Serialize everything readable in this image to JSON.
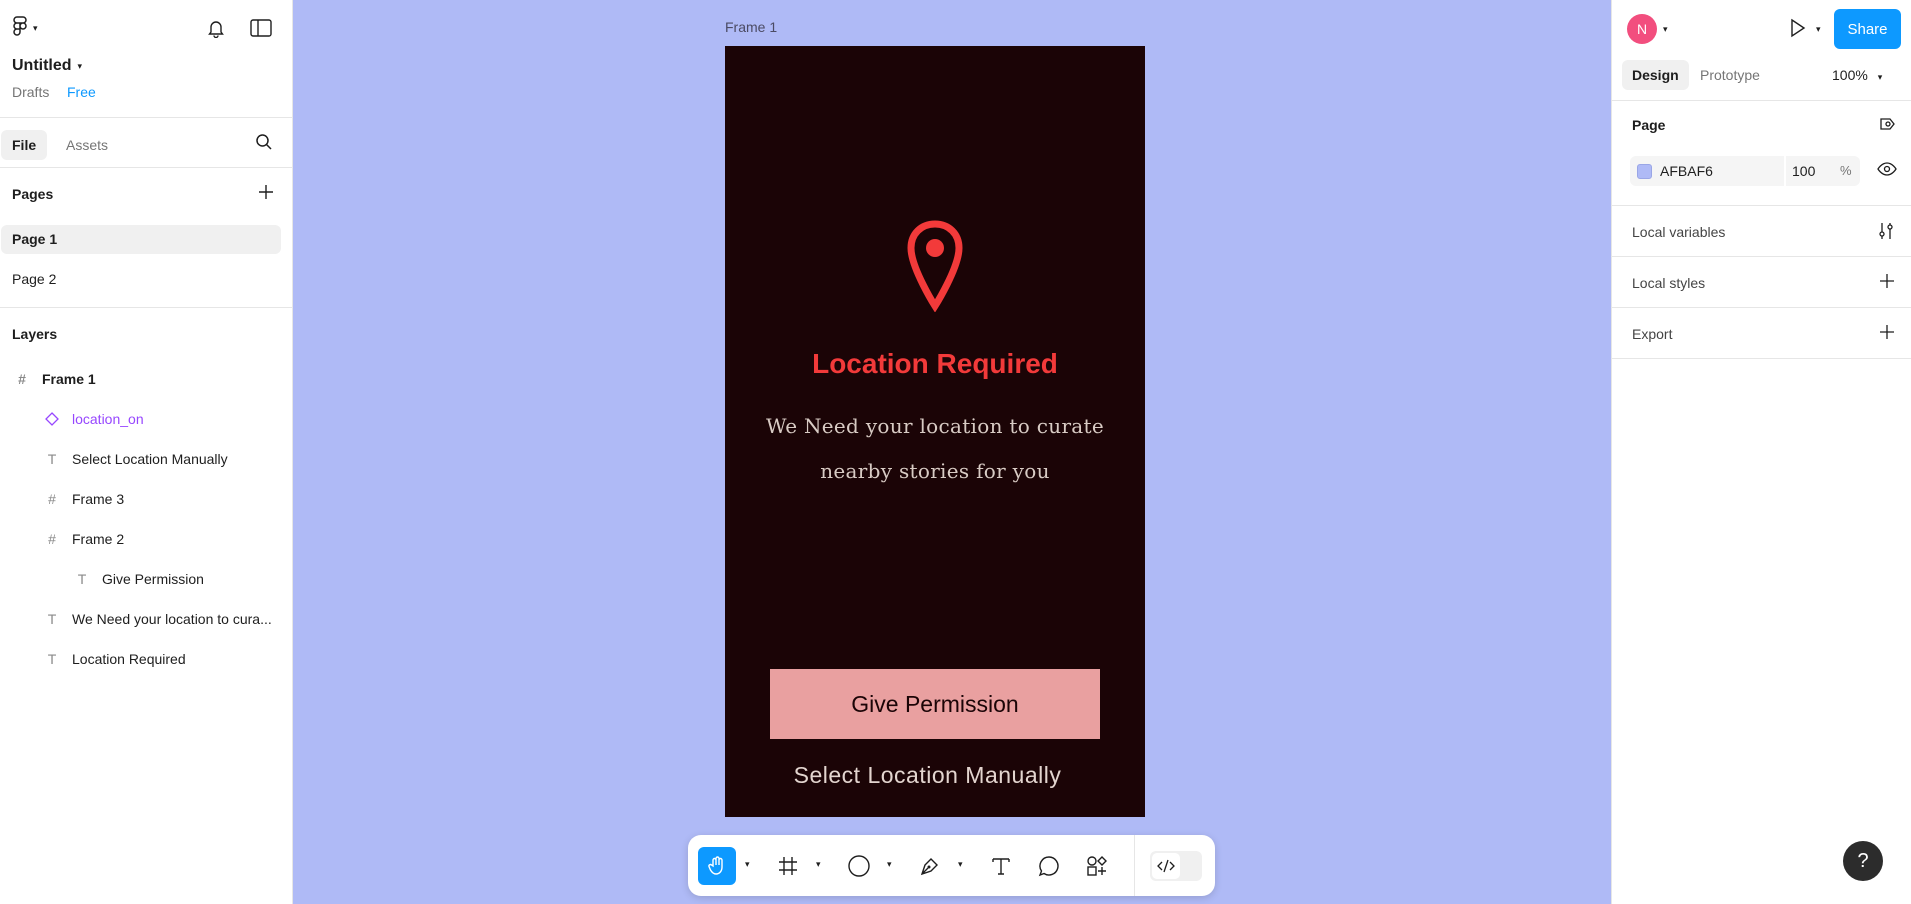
{
  "file": {
    "name": "Untitled",
    "location": "Drafts",
    "plan": "Free"
  },
  "left_tabs": {
    "file": "File",
    "assets": "Assets"
  },
  "pages": {
    "title": "Pages",
    "items": [
      "Page 1",
      "Page 2"
    ]
  },
  "layers": {
    "title": "Layers",
    "items": [
      {
        "name": "Frame 1",
        "type": "frame"
      },
      {
        "name": "location_on",
        "type": "component"
      },
      {
        "name": "Select Location Manually",
        "type": "text"
      },
      {
        "name": "Frame 3",
        "type": "frame"
      },
      {
        "name": "Frame 2",
        "type": "frame"
      },
      {
        "name": "Give Permission",
        "type": "text"
      },
      {
        "name": "We Need your location to cura...",
        "type": "text"
      },
      {
        "name": "Location Required",
        "type": "text"
      }
    ]
  },
  "canvas": {
    "frame_label": "Frame 1",
    "frame": {
      "title": "Location Required",
      "description": "We Need your location to curate nearby stories for you",
      "button": "Give Permission",
      "secondary": "Select Location Manually"
    }
  },
  "toolbar": {
    "tools": [
      "hand-tool",
      "frame-tool",
      "ellipse-tool",
      "pen-tool",
      "text-tool",
      "comment-tool",
      "actions-tool"
    ],
    "active": "hand-tool"
  },
  "right": {
    "user_initial": "N",
    "share": "Share",
    "tabs": {
      "design": "Design",
      "prototype": "Prototype"
    },
    "zoom": "100%",
    "page_section": {
      "title": "Page",
      "fill_hex": "AFBAF6",
      "opacity": "100",
      "percent": "%"
    },
    "local_variables": "Local variables",
    "local_styles": "Local styles",
    "export": "Export",
    "help": "?"
  },
  "colors": {
    "canvas_bg": "#afbaf6",
    "frame_bg": "#1b0406",
    "accent": "#f23a3a",
    "button_bg": "#e9a0a0",
    "brand_blue": "#0d99ff"
  }
}
